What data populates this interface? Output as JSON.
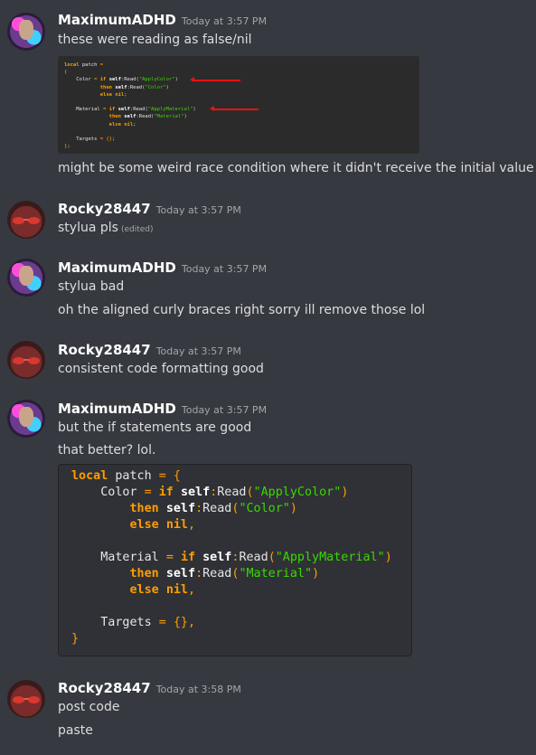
{
  "messages": [
    {
      "username": "MaximumADHD",
      "timestamp": "Today at 3:57 PM",
      "lines": [
        "these were reading as false/nil"
      ],
      "after_image": "might be some weird race condition where it didn't receive the initial value lol."
    },
    {
      "username": "Rocky28447",
      "timestamp": "Today at 3:57 PM",
      "lines": [
        "stylua pls"
      ],
      "edited_label": "(edited)"
    },
    {
      "username": "MaximumADHD",
      "timestamp": "Today at 3:57 PM",
      "lines": [
        "stylua bad",
        "oh the aligned curly braces right sorry ill remove those lol"
      ]
    },
    {
      "username": "Rocky28447",
      "timestamp": "Today at 3:57 PM",
      "lines": [
        "consistent code formatting good"
      ]
    },
    {
      "username": "MaximumADHD",
      "timestamp": "Today at 3:57 PM",
      "lines": [
        "but the if statements are good",
        "that better? lol."
      ]
    },
    {
      "username": "Rocky28447",
      "timestamp": "Today at 3:58 PM",
      "lines": [
        "post code",
        "paste"
      ]
    }
  ],
  "code_image": {
    "tokens": {
      "local": "local",
      "patch": "patch",
      "eq": "=",
      "lbrace": "{",
      "rbrace": "}",
      "color": "Color",
      "if": "if",
      "self": "self",
      "read": "Read",
      "apply_color": "\"ApplyColor\"",
      "color_str": "\"Color\"",
      "then": "then",
      "else": "else",
      "nil": "nil",
      "material": "Material",
      "apply_material": "\"ApplyMaterial\"",
      "material_str": "\"Material\"",
      "targets": "Targets"
    }
  },
  "code_block": {
    "tokens": {
      "local": "local",
      "patch": "patch",
      "eq": "=",
      "lbrace": "{",
      "rbrace": "}",
      "color": "Color",
      "if": "if",
      "self": "self",
      "read": "Read",
      "apply_color": "\"ApplyColor\"",
      "color_str": "\"Color\"",
      "then": "then",
      "else": "else",
      "nil": "nil",
      "material": "Material",
      "apply_material": "\"ApplyMaterial\"",
      "material_str": "\"Material\"",
      "targets": "Targets",
      "empty_table": "{}"
    }
  },
  "colors": {
    "background": "#36393f",
    "code_keyword": "#ff9d00",
    "code_string": "#3ad900",
    "arrow": "#ee1111"
  }
}
